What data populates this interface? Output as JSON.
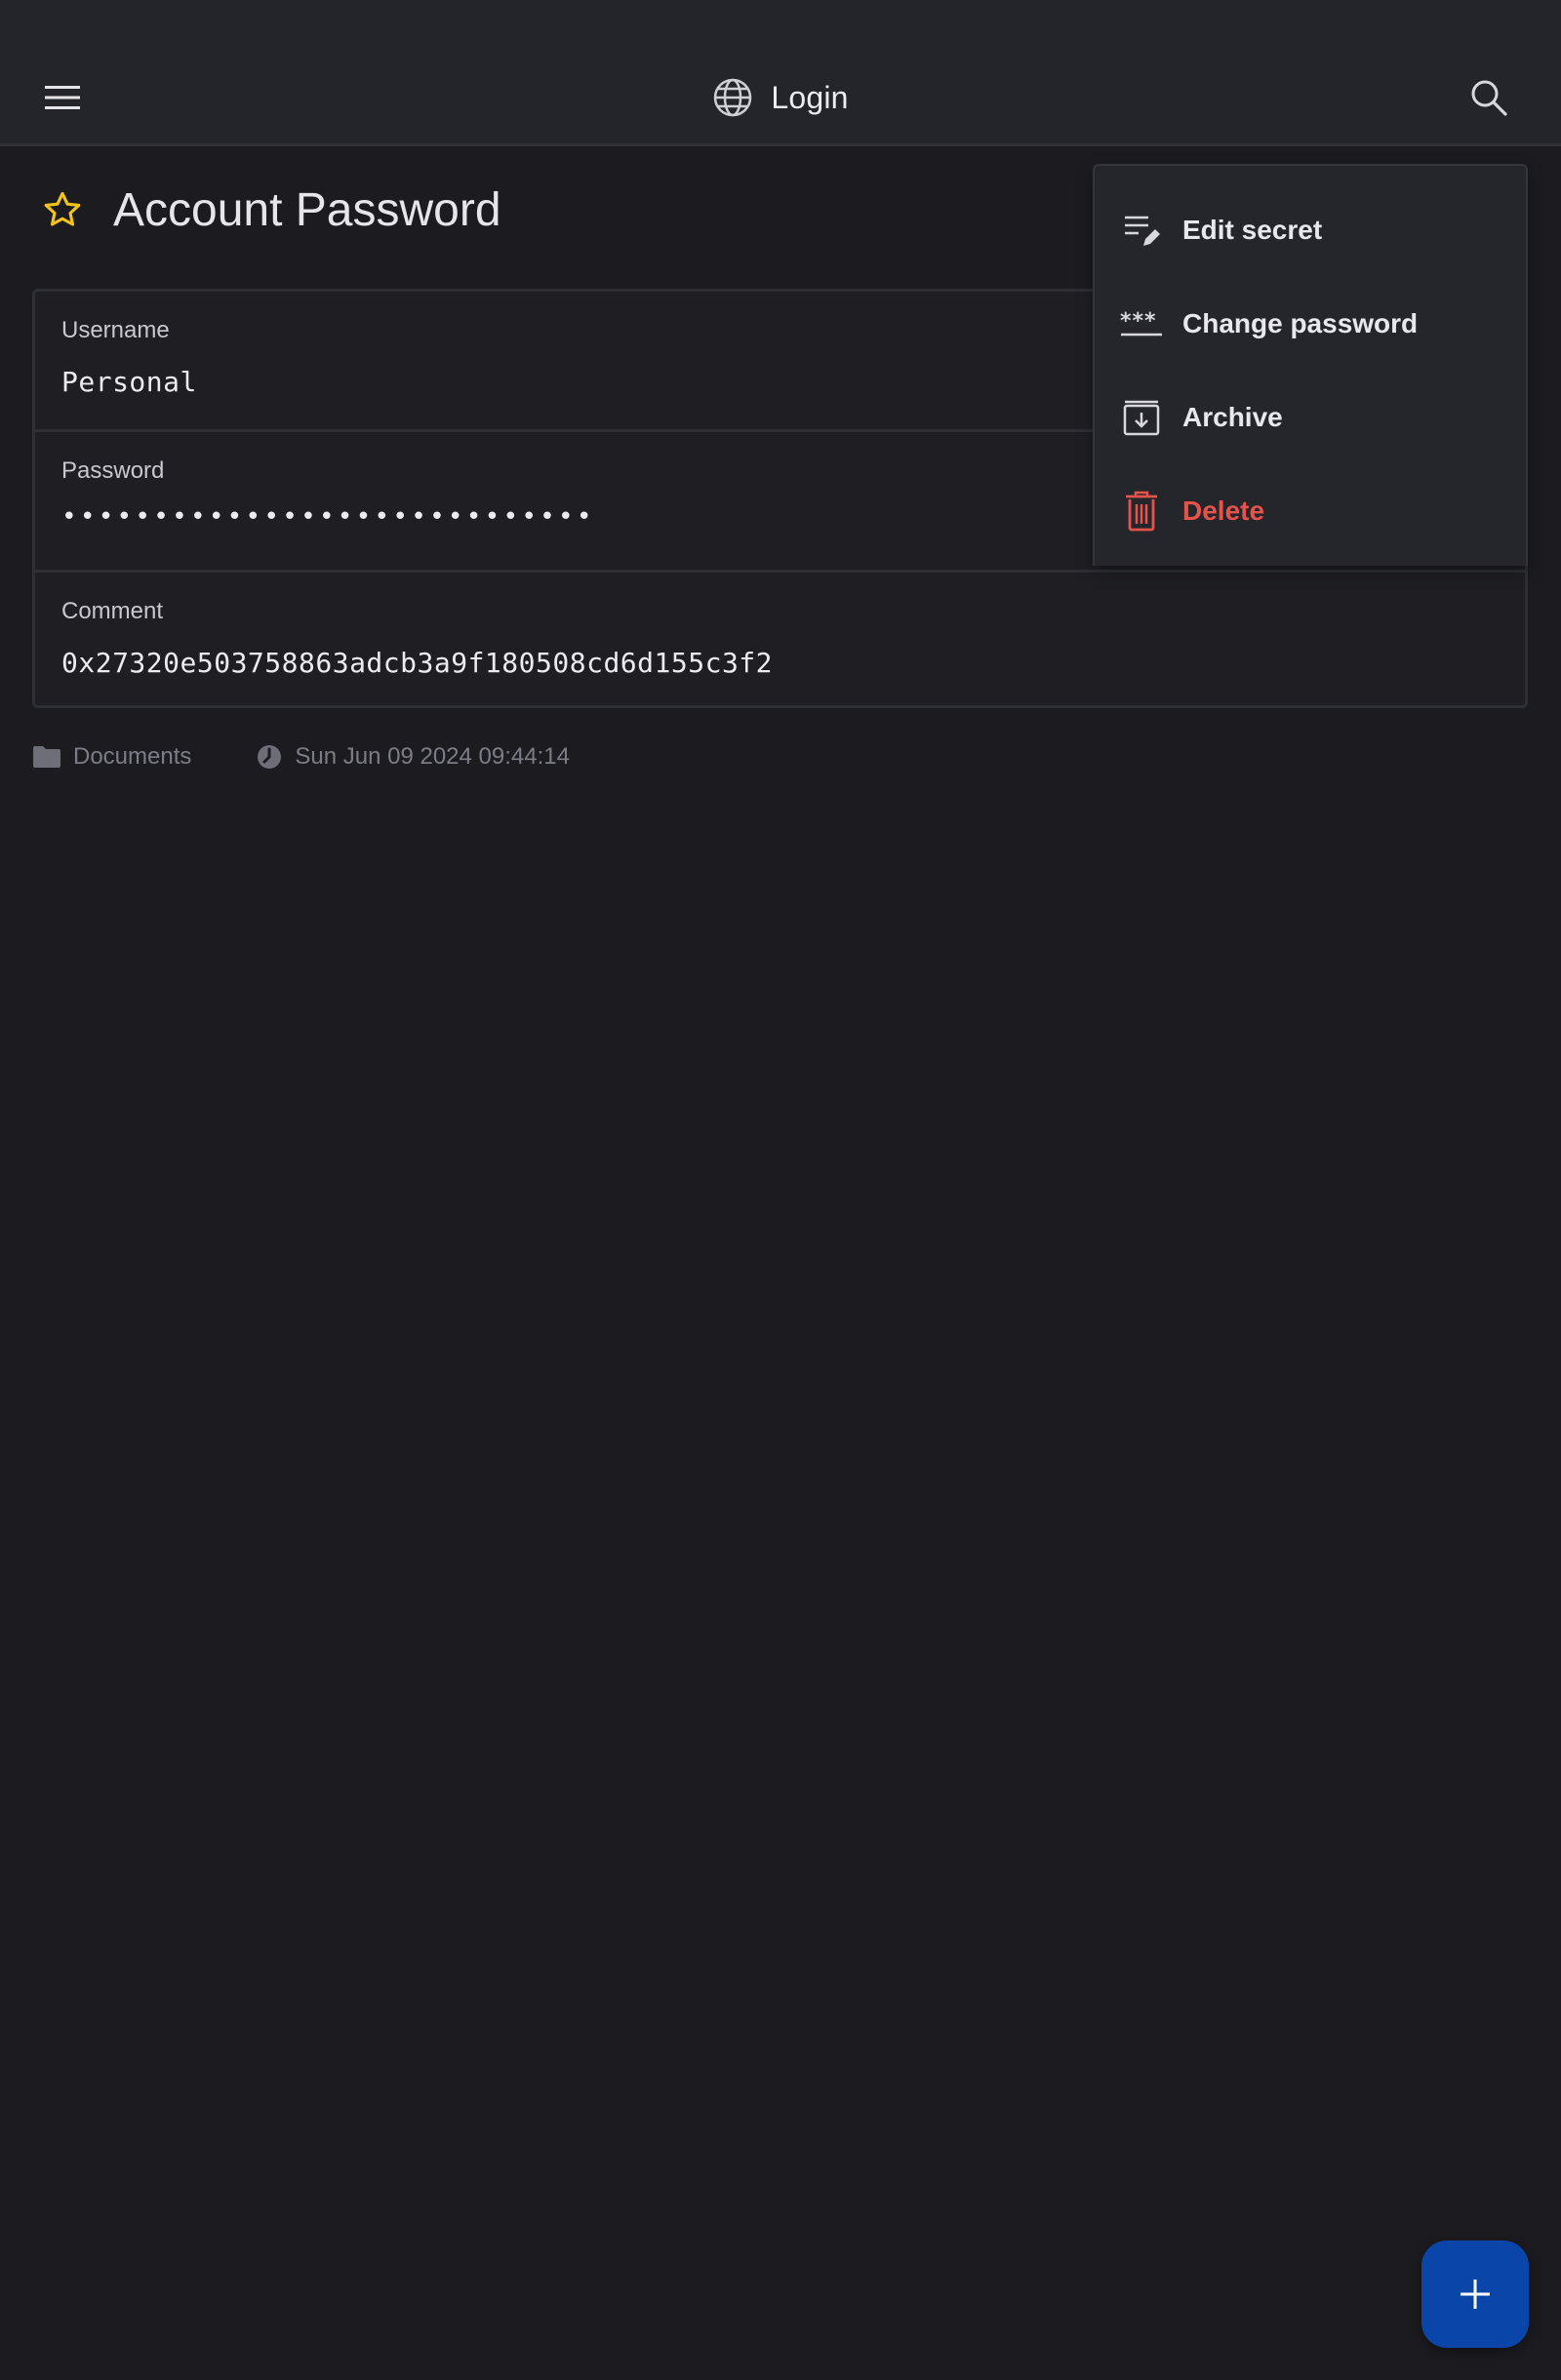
{
  "appbar": {
    "title": "Login",
    "menu_icon": "hamburger-menu-icon",
    "title_icon": "globe-icon",
    "search_icon": "search-icon"
  },
  "entry": {
    "title": "Account Password",
    "favorite_icon": "star-outline-icon",
    "favorite_color": "#f2c318"
  },
  "fields": [
    {
      "label": "Username",
      "value": "Personal"
    },
    {
      "label": "Password",
      "value": "•••••••••••••••••••••••••••••"
    },
    {
      "label": "Comment",
      "value": "0x27320e503758863adcb3a9f180508cd6d155c3f2"
    }
  ],
  "meta": {
    "folder": "Documents",
    "folder_icon": "folder-icon",
    "modified": "Sun Jun 09 2024 09:44:14",
    "clock_icon": "clock-icon"
  },
  "menu": {
    "items": [
      {
        "label": "Edit secret",
        "icon": "edit-secret-icon"
      },
      {
        "label": "Change password",
        "icon": "change-password-icon"
      },
      {
        "label": "Archive",
        "icon": "archive-icon"
      },
      {
        "label": "Delete",
        "icon": "trash-icon",
        "color": "#e5534b"
      }
    ]
  },
  "fab": {
    "icon": "plus-icon",
    "color": "#0a45aa"
  }
}
